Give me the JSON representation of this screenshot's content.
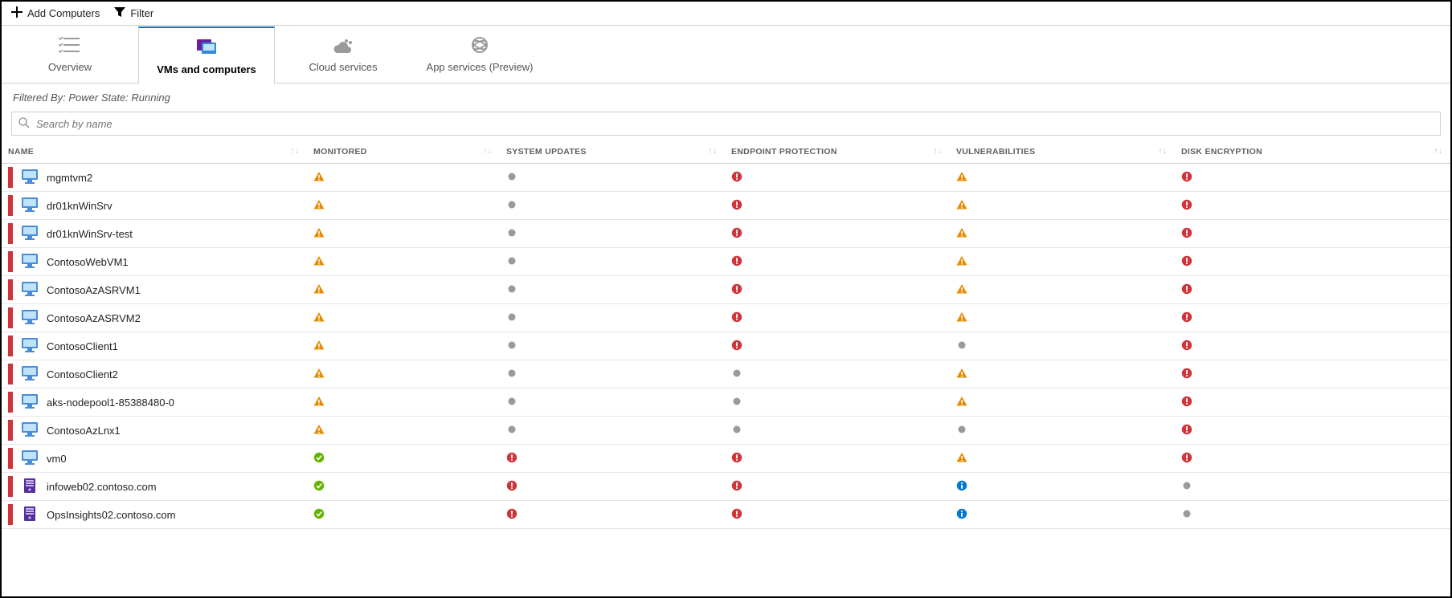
{
  "commands": {
    "add": "Add Computers",
    "filter": "Filter"
  },
  "tabs": [
    {
      "id": "overview",
      "label": "Overview"
    },
    {
      "id": "vms",
      "label": "VMs and computers"
    },
    {
      "id": "cloud",
      "label": "Cloud services"
    },
    {
      "id": "app",
      "label": "App services (Preview)"
    }
  ],
  "active_tab": "vms",
  "filtered_by": "Filtered By: Power State: Running",
  "search_placeholder": "Search by name",
  "columns": {
    "name": "NAME",
    "monitored": "MONITORED",
    "system_updates": "SYSTEM UPDATES",
    "endpoint_protection": "ENDPOINT PROTECTION",
    "vulnerabilities": "VULNERABILITIES",
    "disk_encryption": "DISK ENCRYPTION"
  },
  "rows": [
    {
      "name": "mgmtvm2",
      "kind": "vm",
      "monitored": "warn",
      "system_updates": "grey",
      "endpoint_protection": "error",
      "vulnerabilities": "warn",
      "disk_encryption": "error"
    },
    {
      "name": "dr01knWinSrv",
      "kind": "vm",
      "monitored": "warn",
      "system_updates": "grey",
      "endpoint_protection": "error",
      "vulnerabilities": "warn",
      "disk_encryption": "error"
    },
    {
      "name": "dr01knWinSrv-test",
      "kind": "vm",
      "monitored": "warn",
      "system_updates": "grey",
      "endpoint_protection": "error",
      "vulnerabilities": "warn",
      "disk_encryption": "error"
    },
    {
      "name": "ContosoWebVM1",
      "kind": "vm",
      "monitored": "warn",
      "system_updates": "grey",
      "endpoint_protection": "error",
      "vulnerabilities": "warn",
      "disk_encryption": "error"
    },
    {
      "name": "ContosoAzASRVM1",
      "kind": "vm",
      "monitored": "warn",
      "system_updates": "grey",
      "endpoint_protection": "error",
      "vulnerabilities": "warn",
      "disk_encryption": "error"
    },
    {
      "name": "ContosoAzASRVM2",
      "kind": "vm",
      "monitored": "warn",
      "system_updates": "grey",
      "endpoint_protection": "error",
      "vulnerabilities": "warn",
      "disk_encryption": "error"
    },
    {
      "name": "ContosoClient1",
      "kind": "vm",
      "monitored": "warn",
      "system_updates": "grey",
      "endpoint_protection": "error",
      "vulnerabilities": "grey",
      "disk_encryption": "error"
    },
    {
      "name": "ContosoClient2",
      "kind": "vm",
      "monitored": "warn",
      "system_updates": "grey",
      "endpoint_protection": "grey",
      "vulnerabilities": "warn",
      "disk_encryption": "error"
    },
    {
      "name": "aks-nodepool1-85388480-0",
      "kind": "vm",
      "monitored": "warn",
      "system_updates": "grey",
      "endpoint_protection": "grey",
      "vulnerabilities": "warn",
      "disk_encryption": "error"
    },
    {
      "name": "ContosoAzLnx1",
      "kind": "vm",
      "monitored": "warn",
      "system_updates": "grey",
      "endpoint_protection": "grey",
      "vulnerabilities": "grey",
      "disk_encryption": "error"
    },
    {
      "name": "vm0",
      "kind": "vm",
      "monitored": "ok",
      "system_updates": "error",
      "endpoint_protection": "error",
      "vulnerabilities": "warn",
      "disk_encryption": "error"
    },
    {
      "name": "infoweb02.contoso.com",
      "kind": "host",
      "monitored": "ok",
      "system_updates": "error",
      "endpoint_protection": "error",
      "vulnerabilities": "info",
      "disk_encryption": "grey"
    },
    {
      "name": "OpsInsights02.contoso.com",
      "kind": "host",
      "monitored": "ok",
      "system_updates": "error",
      "endpoint_protection": "error",
      "vulnerabilities": "info",
      "disk_encryption": "grey"
    }
  ]
}
